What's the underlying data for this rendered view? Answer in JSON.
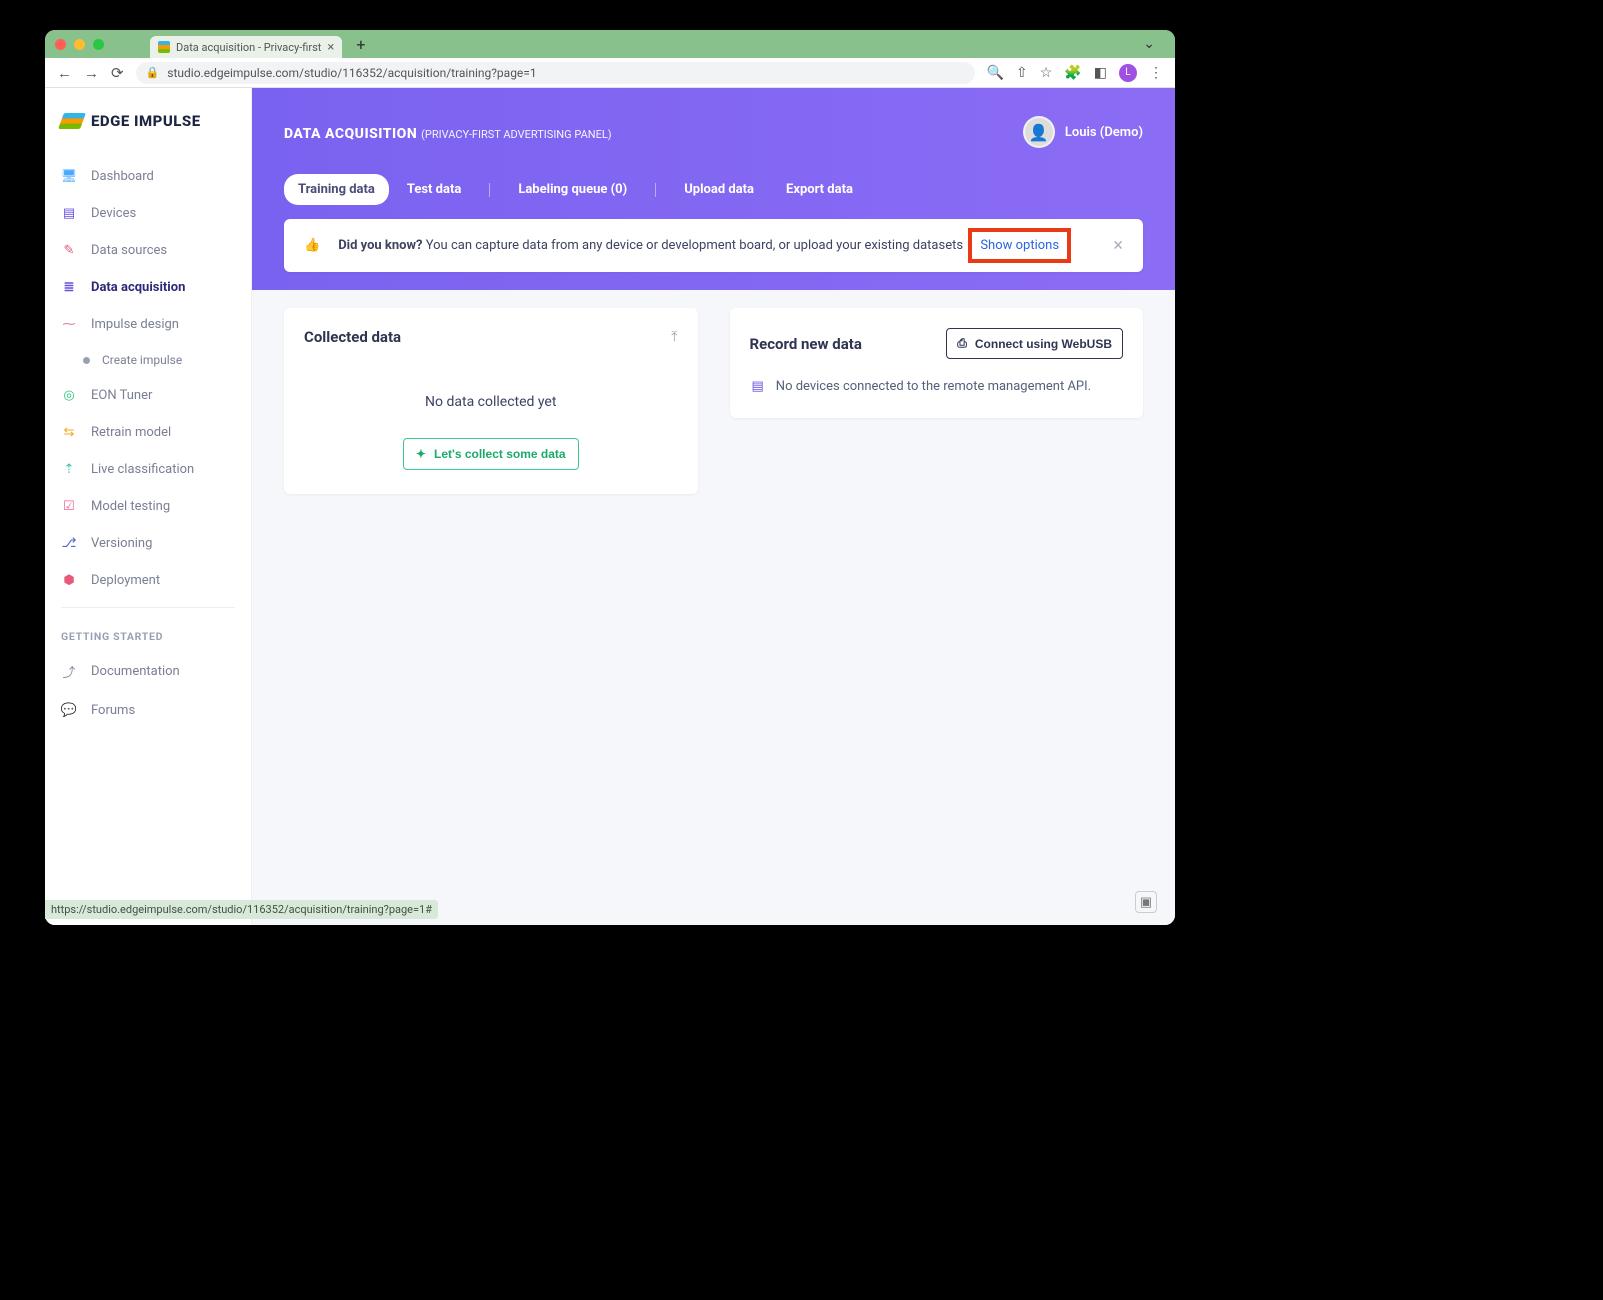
{
  "browser": {
    "tab_title": "Data acquisition - Privacy-first",
    "url": "studio.edgeimpulse.com/studio/116352/acquisition/training?page=1",
    "profile_letter": "L"
  },
  "logo": "EDGE IMPULSE",
  "sidebar": {
    "items": [
      {
        "label": "Dashboard",
        "icon": "🖥",
        "cls": "ic-blue"
      },
      {
        "label": "Devices",
        "icon": "▤",
        "cls": "ic-purple"
      },
      {
        "label": "Data sources",
        "icon": "✎",
        "cls": "ic-red"
      },
      {
        "label": "Data acquisition",
        "icon": "≣",
        "cls": "ic-purple",
        "active": true
      },
      {
        "label": "Impulse design",
        "icon": "⁓",
        "cls": "ic-pink"
      },
      {
        "label": "Create impulse",
        "sub": true
      },
      {
        "label": "EON Tuner",
        "icon": "◎",
        "cls": "ic-green"
      },
      {
        "label": "Retrain model",
        "icon": "⇆",
        "cls": "ic-orange"
      },
      {
        "label": "Live classification",
        "icon": "⇡",
        "cls": "ic-teal"
      },
      {
        "label": "Model testing",
        "icon": "☑",
        "cls": "ic-rose"
      },
      {
        "label": "Versioning",
        "icon": "⎇",
        "cls": "ic-indigo"
      },
      {
        "label": "Deployment",
        "icon": "⬢",
        "cls": "ic-red"
      }
    ],
    "gs_header": "GETTING STARTED",
    "gs_items": [
      {
        "label": "Documentation",
        "icon": "⤴",
        "cls": "ic-gray"
      },
      {
        "label": "Forums",
        "icon": "💬",
        "cls": "ic-gray"
      }
    ]
  },
  "header": {
    "title": "DATA ACQUISITION",
    "subtitle": "(PRIVACY-FIRST ADVERTISING PANEL)",
    "user_name": "Louis (Demo)"
  },
  "tabs": [
    {
      "label": "Training data",
      "active": true
    },
    {
      "label": "Test data"
    },
    {
      "label": "Labeling queue (0)",
      "sep_before": true
    },
    {
      "label": "Upload data",
      "sep_before": true
    },
    {
      "label": "Export data"
    }
  ],
  "banner": {
    "bold": "Did you know?",
    "text": "You can capture data from any device or development board, or upload your existing datasets",
    "link": "Show options"
  },
  "left_card": {
    "title": "Collected data",
    "empty": "No data collected yet",
    "cta": "Let's collect some data"
  },
  "right_card": {
    "title": "Record new data",
    "usb_btn": "Connect using WebUSB",
    "no_devices": "No devices connected to the remote management API."
  },
  "status_url": "https://studio.edgeimpulse.com/studio/116352/acquisition/training?page=1#"
}
